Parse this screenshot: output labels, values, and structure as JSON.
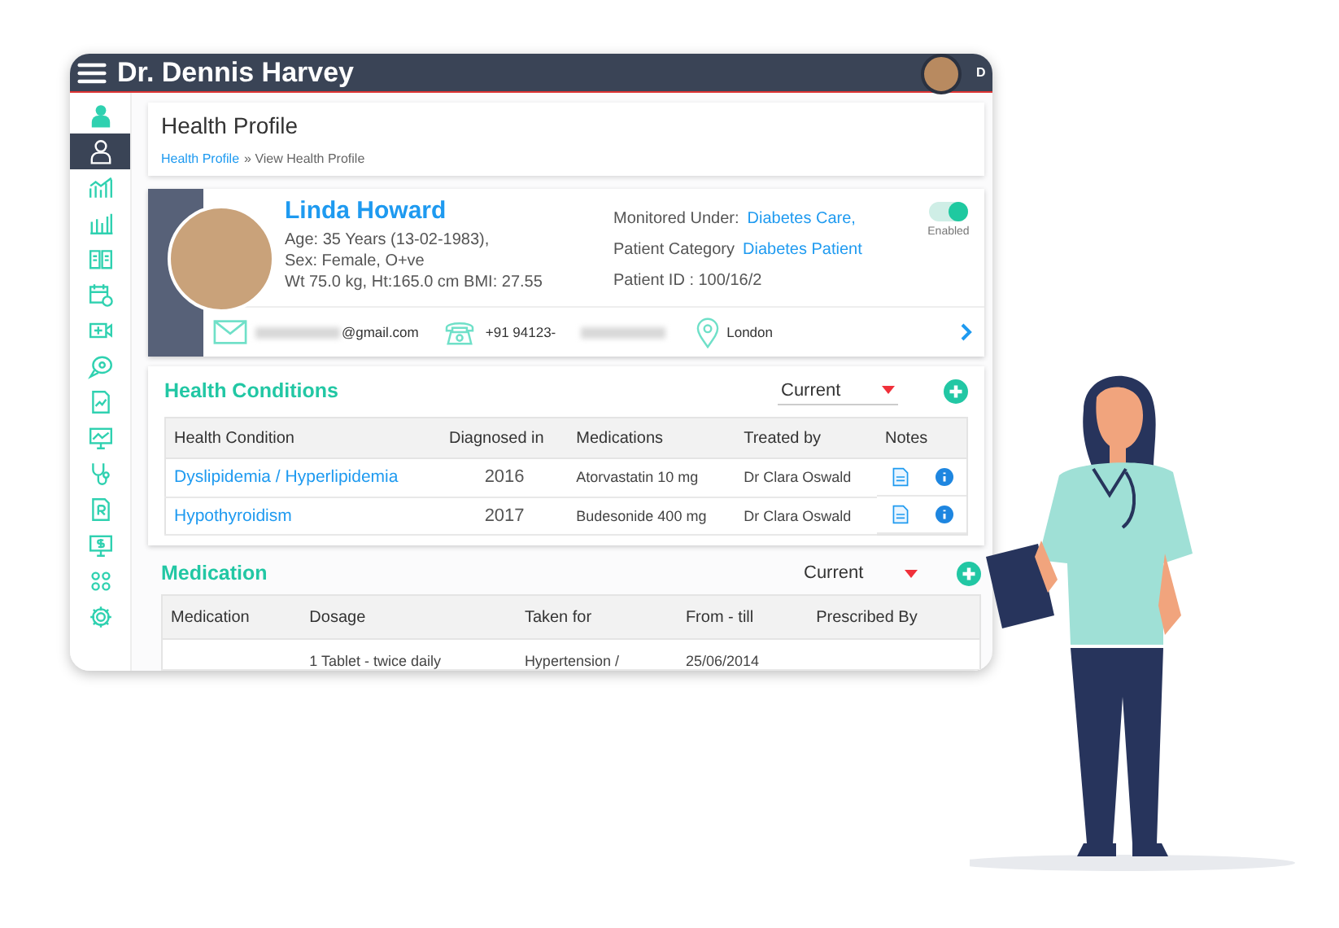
{
  "header": {
    "title": "Dr. Dennis Harvey",
    "user_initial": "D"
  },
  "sidebar": {
    "items": [
      {
        "kind": "doctor",
        "selected": false
      },
      {
        "kind": "person",
        "selected": true
      },
      {
        "kind": "chart-line",
        "selected": false
      },
      {
        "kind": "chart-bars",
        "selected": false
      },
      {
        "kind": "book",
        "selected": false
      },
      {
        "kind": "calendar",
        "selected": false
      },
      {
        "kind": "video",
        "selected": false
      },
      {
        "kind": "chat",
        "selected": false
      },
      {
        "kind": "report",
        "selected": false
      },
      {
        "kind": "monitor",
        "selected": false
      },
      {
        "kind": "stethoscope",
        "selected": false
      },
      {
        "kind": "prescription",
        "selected": false
      },
      {
        "kind": "billing",
        "selected": false
      },
      {
        "kind": "group",
        "selected": false
      },
      {
        "kind": "settings",
        "selected": false
      }
    ]
  },
  "page": {
    "title": "Health Profile",
    "breadcrumb_link": "Health Profile",
    "breadcrumb_current": "» View Health Profile"
  },
  "patient": {
    "name": "Linda Howard",
    "details": [
      "Age: 35 Years (13-02-1983),",
      "Sex: Female, O+ve",
      "Wt 75.0 kg, Ht:165.0 cm BMI: 27.55"
    ],
    "info": [
      {
        "label": "Monitored Under:",
        "value": "Diabetes Care,"
      },
      {
        "label": "Patient Category",
        "value": "Diabetes Patient"
      },
      {
        "label": "Patient ID : 100/16/2"
      }
    ],
    "toggle": {
      "on": true,
      "label": "Enabled"
    },
    "email": "@gmail.com",
    "phone": "+91 94123-",
    "location": "London"
  },
  "health_conditions": {
    "title": "Health Conditions",
    "filter": "Current",
    "columns": [
      "Health Condition",
      "Diagnosed in",
      "Medications",
      "Treated by",
      "Notes"
    ],
    "rows": [
      {
        "condition": "Dyslipidemia / Hyperlipidemia",
        "year": "2016",
        "medication": "Atorvastatin 10 mg",
        "doctor": "Dr Clara Oswald"
      },
      {
        "condition": "Hypothyroidism",
        "year": "2017",
        "medication": "Budesonide 400 mg",
        "doctor": "Dr Clara Oswald"
      }
    ]
  },
  "medication": {
    "title": "Medication",
    "filter": "Current",
    "columns": [
      "Medication",
      "Dosage",
      "Taken for",
      "From - till",
      "Prescribed By"
    ],
    "rows": [
      [
        "",
        "1 Tablet - twice daily",
        "Hypertension /",
        "25/06/2014",
        ""
      ]
    ]
  }
}
